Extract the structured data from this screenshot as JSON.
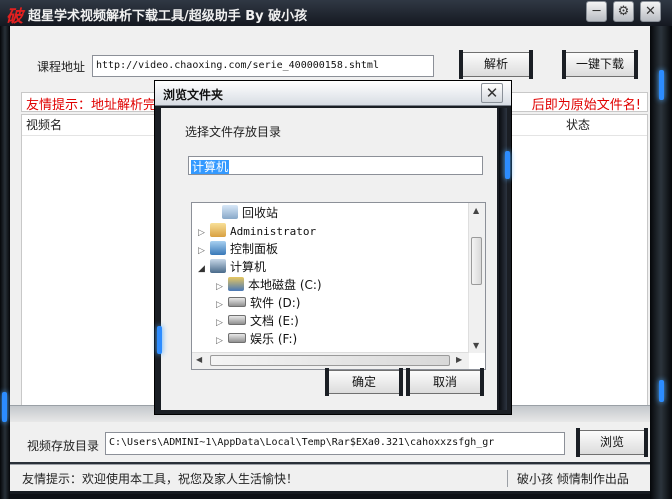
{
  "window": {
    "logo_char": "破",
    "title": "超星学术视频解析下载工具/超级助手 By 破小孩",
    "controls": {
      "minimize": "─",
      "settings": "⚙",
      "close": "✕"
    }
  },
  "course": {
    "label": "课程地址",
    "url": "http://video.chaoxing.com/serie_400000158.shtml",
    "parse_button": "解析",
    "download_all_button": "一键下载"
  },
  "notice": {
    "left": "友情提示：地址解析完",
    "right": "后即为原始文件名!"
  },
  "table": {
    "columns": [
      "视频名",
      "状态"
    ]
  },
  "save": {
    "label": "视频存放目录",
    "path": "C:\\Users\\ADMINI~1\\AppData\\Local\\Temp\\Rar$EXa0.321\\cahoxxzsfgh_gr",
    "browse_button": "浏览"
  },
  "status": {
    "left": "友情提示：欢迎使用本工具，祝您及家人生活愉快！",
    "right": "破小孩 倾情制作出品"
  },
  "dialog": {
    "title": "浏览文件夹",
    "close": "✕",
    "prompt": "选择文件存放目录",
    "selected": "计算机",
    "tree": [
      {
        "label": "回收站",
        "icon": "recycle-bin-icon",
        "depth": 1,
        "arrow": ""
      },
      {
        "label": "Administrator",
        "icon": "user-folder-icon",
        "depth": 0,
        "arrow": "▷"
      },
      {
        "label": "控制面板",
        "icon": "control-panel-icon",
        "depth": 0,
        "arrow": "▷"
      },
      {
        "label": "计算机",
        "icon": "computer-icon",
        "depth": 0,
        "arrow": "◢"
      },
      {
        "label": "本地磁盘 (C:)",
        "icon": "system-drive-icon",
        "depth": 1,
        "arrow": "▷"
      },
      {
        "label": "软件 (D:)",
        "icon": "drive-icon",
        "depth": 1,
        "arrow": "▷"
      },
      {
        "label": "文档 (E:)",
        "icon": "drive-icon",
        "depth": 1,
        "arrow": "▷"
      },
      {
        "label": "娱乐 (F:)",
        "icon": "drive-icon",
        "depth": 1,
        "arrow": "▷"
      }
    ],
    "ok_button": "确定",
    "cancel_button": "取消"
  },
  "colors": {
    "notice_red": "#e00000",
    "accent_blue": "#2c8cff",
    "selection": "#3399ff"
  }
}
